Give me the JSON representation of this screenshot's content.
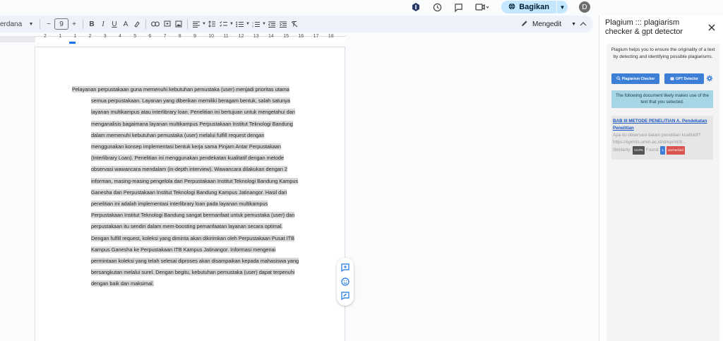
{
  "topbar": {
    "share_label": "Bagikan",
    "avatar_letter": "D"
  },
  "toolbar": {
    "font": "Merriweather / Perdana",
    "font_visible": "erdana",
    "font_size": "9",
    "minus": "−",
    "plus": "+",
    "bold": "B",
    "italic": "I",
    "underline": "U",
    "text_color": "A",
    "mode_label": "Mengedit"
  },
  "ruler": {
    "numbers": [
      "2",
      "1",
      "1",
      "2",
      "3",
      "4",
      "5",
      "6",
      "7",
      "8",
      "9",
      "10",
      "11",
      "12",
      "13",
      "14",
      "15",
      "16",
      "17",
      "18"
    ]
  },
  "document": {
    "lines": [
      {
        "indent": false,
        "text": "Pelayanan perpustakaan guna memenuhi kebutuhan pemustaka (user) menjadi prioritas utama"
      },
      {
        "indent": true,
        "text": "semua perpustakaan. Layanan yang diberikan memiliki beragam bentuk, salah satunya"
      },
      {
        "indent": true,
        "text": "layanan multikampus atau interlibrary loan. Penelitian ini bertujuan untuk mengetahui dan"
      },
      {
        "indent": true,
        "text": "menganalisis bagaimana layanan multikampus Perpustakaan Institut Teknologi Bandung"
      },
      {
        "indent": true,
        "text": "dalam memenuhi kebutuhan pemustaka (user) melalui fulfill request dengan"
      },
      {
        "indent": true,
        "text": "menggunakan konsep implementasi bentuk kerja sama Pinjam Antar Perpustakaan"
      },
      {
        "indent": true,
        "text": "(Interlibrary Loan). Penelitian ini menggunakan pendekatan kualitatif dengan metode"
      },
      {
        "indent": true,
        "text": "observasi wawancara mendalam (in-depth interview). Wawancara dilakukan dengan 2"
      },
      {
        "indent": true,
        "text": "informan, masing-masing pengelola dari Perpustakaan Institut Teknologi Bandung Kampus"
      },
      {
        "indent": true,
        "text": "Ganesha dan Perpustakaan Institut Teknologi Bandung Kampus Jatinangor. Hasil dari"
      },
      {
        "indent": true,
        "text": "penelitian ini adalah implementasi interlibrary loan pada layanan multikampus"
      },
      {
        "indent": true,
        "text": "Perpustakaan Institut Teknologi Bandung sangat bermanfaat untuk pemustaka (user) dan"
      },
      {
        "indent": true,
        "text": "perpustakaan itu sendiri dalam mem-boosting pemanfaatan layanan secara optimal."
      },
      {
        "indent": true,
        "text": "Dengan fulfill request, koleksi yang diminta akan dikirimkan oleh Perpustakaan Pusat ITB"
      },
      {
        "indent": true,
        "text": "Kampus Ganesha ke Perpustakaan ITB Kampus Jatinangor. Informasi mengenai"
      },
      {
        "indent": true,
        "text": "permintaan koleksi yang telah selesai diproses akan disampaikan kepada mahasiswa yang"
      },
      {
        "indent": true,
        "text": "bersangkutan melalui surel. Dengan begitu, kebutuhan pemustaka (user) dapat terpenuhi"
      },
      {
        "indent": true,
        "text": "dengan baik dan maksimal."
      }
    ]
  },
  "side_panel": {
    "title": "Plagium ::: plagiarism checker & gpt detector",
    "intro": "Plagium helps you to ensure the originality of a text by detecting and identifying possible plagiarisms.",
    "btn_plagium": "Plagiarism Checker",
    "btn_gpt": "GPT Detector",
    "notice": "The following document likely makes use of the text that you selected.",
    "result": {
      "title": "BAB III METODE PENELITIAN A. Pendekatan Penelitian",
      "snippet": "Apa itu observasi dalam penelitian kualitatif?",
      "url": "https://eprints.umm.ac.id/id/eprint/8...",
      "similarity_label": "Similarity:",
      "similarity_value": "13.8%",
      "found_label": "Found:",
      "found_value": "1",
      "status": "unchecked"
    }
  },
  "colors": {
    "accent": "#1a73e8",
    "share_bg": "#c2e7ff",
    "highlight": "#d9d9d9",
    "panel_button": "#3d7fd6",
    "notice_bg": "#a6d5e6",
    "unchecked": "#d9534f"
  }
}
